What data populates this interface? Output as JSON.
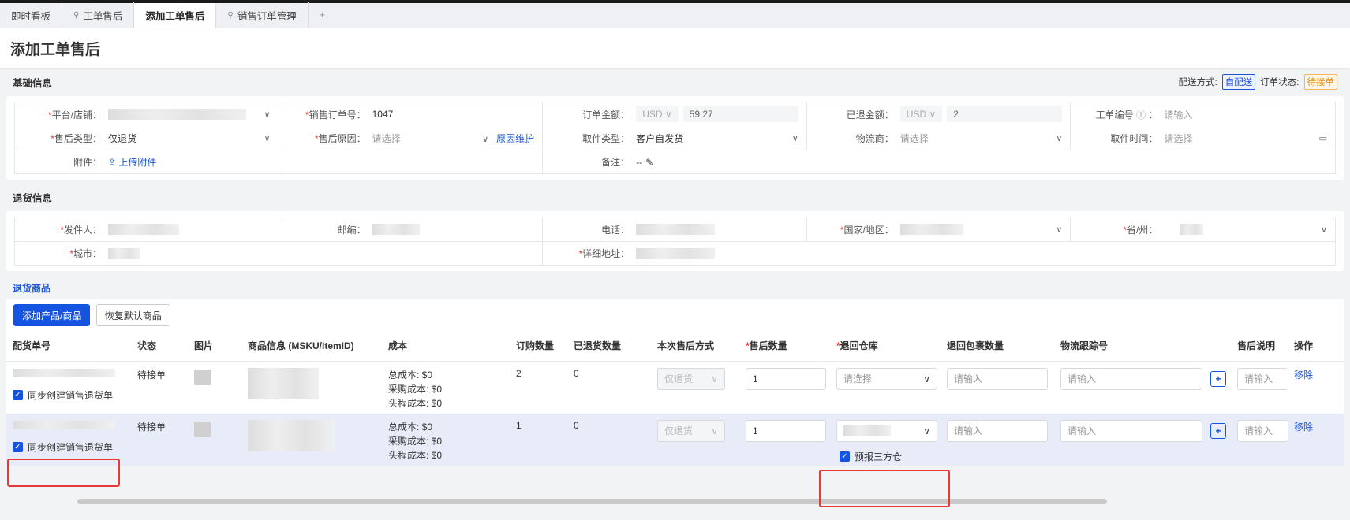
{
  "tabs": [
    {
      "label": "即时看板"
    },
    {
      "label": "工单售后",
      "pinned": true
    },
    {
      "label": "添加工单售后",
      "active": true
    },
    {
      "label": "销售订单管理",
      "pinned": true
    },
    {
      "label": "+"
    }
  ],
  "page_title": "添加工单售后",
  "basic": {
    "title": "基础信息",
    "delivery_label": "配送方式:",
    "delivery_value": "自配送",
    "status_label": "订单状态:",
    "status_value": "待接单",
    "platform_label": "平台/店铺：",
    "order_no_label": "销售订单号：",
    "order_no": "1047",
    "order_amount_label": "订单金额：",
    "currency": "USD",
    "order_amount": "59.27",
    "refunded_label": "已退金额：",
    "refunded": "2",
    "ticket_label": "工单编号",
    "ticket_ph": "请输入",
    "type_label": "售后类型：",
    "type_value": "仅退货",
    "reason_label": "售后原因：",
    "reason_ph": "请选择",
    "reason_link": "原因维护",
    "pickup_label": "取件类型：",
    "pickup_value": "客户自发货",
    "carrier_label": "物流商：",
    "carrier_ph": "请选择",
    "pickup_time_label": "取件时间：",
    "pickup_time_ph": "请选择",
    "attach_label": "附件：",
    "attach_link": "上传附件",
    "remark_label": "备注：",
    "remark_value": "--"
  },
  "returns": {
    "title": "退货信息",
    "sender": "发件人：",
    "zip": "邮编：",
    "phone": "电话：",
    "country": "国家/地区：",
    "province": "省/州：",
    "city": "城市：",
    "address": "详细地址："
  },
  "goods": {
    "title": "退货商品",
    "add_btn": "添加产品/商品",
    "restore_btn": "恢复默认商品",
    "columns": [
      "配货单号",
      "状态",
      "图片",
      "商品信息 (MSKU/ItemID)",
      "成本",
      "订购数量",
      "已退货数量",
      "本次售后方式",
      "售后数量",
      "退回仓库",
      "退回包裹数量",
      "物流跟踪号",
      "售后说明",
      "操作"
    ],
    "sync_label": "同步创建销售退货单",
    "input_ph": "请输入",
    "select_ph": "请选择",
    "remove": "移除",
    "prereport": "预报三方仓",
    "rows": [
      {
        "status": "待接单",
        "cost_total": "总成本: $0",
        "cost_purchase": "采购成本: $0",
        "cost_head": "头程成本: $0",
        "ordered": "2",
        "returned": "0",
        "method": "仅退货",
        "qty": "1"
      },
      {
        "status": "待接单",
        "cost_total": "总成本: $0",
        "cost_purchase": "采购成本: $0",
        "cost_head": "头程成本: $0",
        "ordered": "1",
        "returned": "0",
        "method": "仅退货",
        "qty": "1"
      }
    ]
  }
}
